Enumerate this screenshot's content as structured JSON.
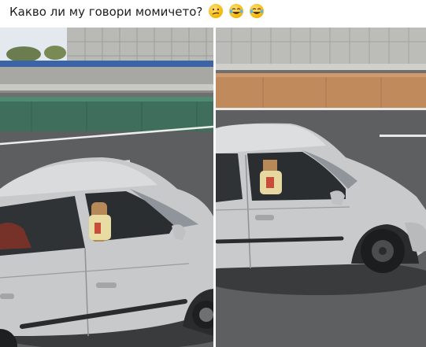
{
  "post": {
    "caption": "Какво ли му говори момичето?",
    "reactions": [
      "confused-face-icon",
      "laughing-tears-icon",
      "laughing-tears-icon"
    ]
  },
  "photos": [
    {
      "name": "photo-left",
      "subject": "silver-hatchback"
    },
    {
      "name": "photo-right",
      "subject": "silver-hatchback"
    }
  ],
  "colors": {
    "car_body": "#c9cbcd",
    "road": "#5f6062",
    "sky": "#dfe6ee"
  }
}
